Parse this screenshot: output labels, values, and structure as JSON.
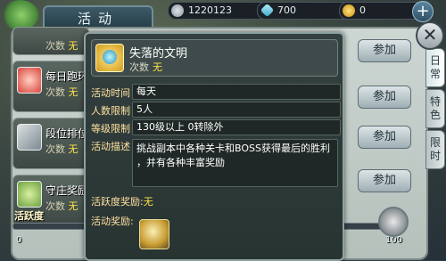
{
  "header": {
    "title": "活动",
    "resources": [
      {
        "icon": "silver-coin-icon",
        "value": "1220123"
      },
      {
        "icon": "crystal-icon",
        "value": "700"
      },
      {
        "icon": "gold-coin-icon",
        "value": "0"
      }
    ],
    "add_label": "+"
  },
  "side_tabs": [
    "日常",
    "特色",
    "限时"
  ],
  "activities": [
    {
      "name": "",
      "count_label": "次数",
      "count_value": "无"
    },
    {
      "name": "每日跑环",
      "count_label": "次数",
      "count_value": "无"
    },
    {
      "name": "段位排位",
      "count_label": "次数",
      "count_value": "无"
    },
    {
      "name": "守庄奖励",
      "count_label": "次数",
      "count_value": "无"
    }
  ],
  "join_label": "参加",
  "activity_bar": {
    "label": "活跃度",
    "fill": 0.0,
    "scale": [
      "0",
      "20",
      "40",
      "60",
      "80",
      "100"
    ]
  },
  "detail": {
    "title": "失落的文明",
    "count_label": "次数",
    "count_value": "无",
    "fields": [
      {
        "label": "活动时间",
        "value": "每天"
      },
      {
        "label": "人数限制",
        "value": "5人"
      },
      {
        "label": "等级限制",
        "value": "130级以上  0转除外"
      }
    ],
    "desc_label": "活动描述",
    "desc_lines": [
      "挑战副本中各种关卡和BOSS获得最后的胜利",
      "，并有各种丰富奖励"
    ],
    "activeness_label": "活跃度奖励:",
    "activeness_value": "无",
    "reward_label": "活动奖励:"
  }
}
